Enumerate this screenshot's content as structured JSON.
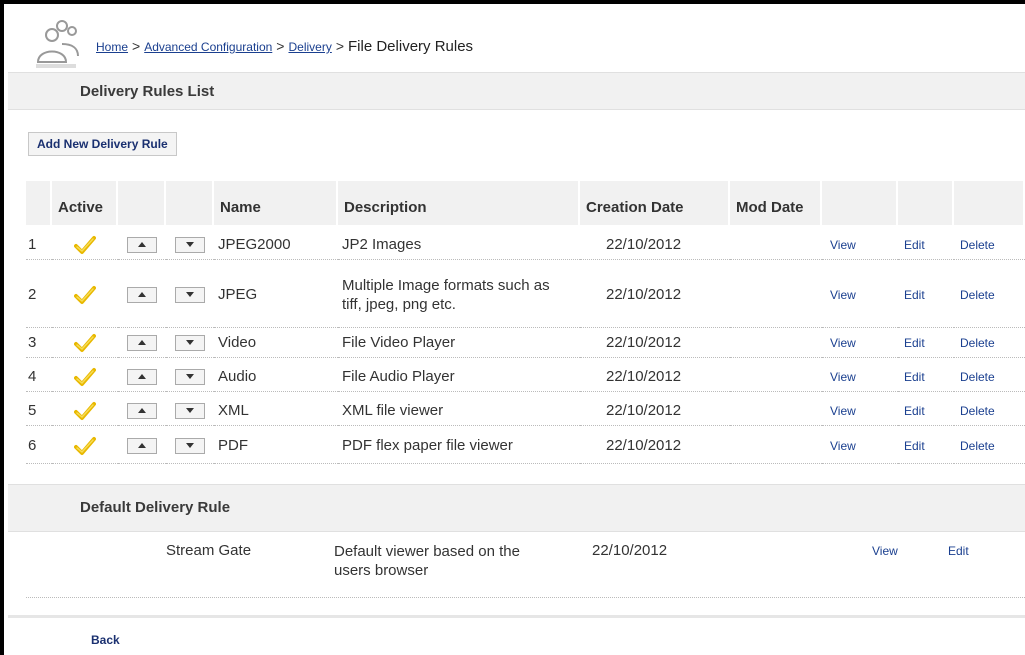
{
  "breadcrumb": {
    "items": [
      "Home",
      "Advanced Configuration",
      "Delivery"
    ],
    "separator": ">",
    "current": "File Delivery Rules"
  },
  "list_section": {
    "title": "Delivery Rules List"
  },
  "add_button": {
    "label": "Add New Delivery Rule"
  },
  "table": {
    "headers": {
      "active": "Active",
      "name": "Name",
      "description": "Description",
      "creation_date": "Creation Date",
      "mod_date": "Mod Date"
    },
    "rows": [
      {
        "num": "1",
        "name": "JPEG2000",
        "description": "JP2 Images",
        "creation_date": "22/10/2012",
        "mod_date": "",
        "view": "View",
        "edit": "Edit",
        "delete": "Delete"
      },
      {
        "num": "2",
        "name": "JPEG",
        "description": "Multiple Image formats such as tiff, jpeg, png etc.",
        "creation_date": "22/10/2012",
        "mod_date": "",
        "view": "View",
        "edit": "Edit",
        "delete": "Delete"
      },
      {
        "num": "3",
        "name": "Video",
        "description": "File Video Player",
        "creation_date": "22/10/2012",
        "mod_date": "",
        "view": "View",
        "edit": "Edit",
        "delete": "Delete"
      },
      {
        "num": "4",
        "name": "Audio",
        "description": "File Audio Player",
        "creation_date": "22/10/2012",
        "mod_date": "",
        "view": "View",
        "edit": "Edit",
        "delete": "Delete"
      },
      {
        "num": "5",
        "name": "XML",
        "description": "XML file viewer",
        "creation_date": "22/10/2012",
        "mod_date": "",
        "view": "View",
        "edit": "Edit",
        "delete": "Delete"
      },
      {
        "num": "6",
        "name": "PDF",
        "description": "PDF flex paper file viewer",
        "creation_date": "22/10/2012",
        "mod_date": "",
        "view": "View",
        "edit": "Edit",
        "delete": "Delete"
      }
    ],
    "active_icon": "checkmark-icon",
    "move_up_icon": "arrow-up-icon",
    "move_down_icon": "arrow-down-icon"
  },
  "default_section": {
    "title": "Default Delivery Rule",
    "row": {
      "name": "Stream Gate",
      "description": "Default viewer based on the users browser",
      "creation_date": "22/10/2012",
      "view": "View",
      "edit": "Edit"
    }
  },
  "back_link": {
    "label": "Back"
  },
  "colors": {
    "link": "#1a3f8f",
    "header_bg": "#f1f1f1",
    "check": "#e0b400"
  }
}
